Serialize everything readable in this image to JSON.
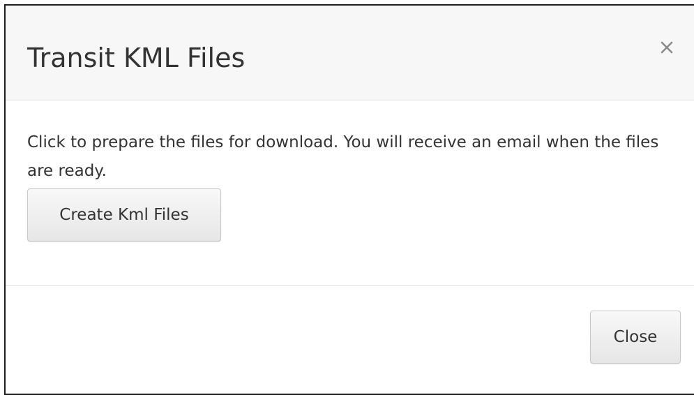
{
  "dialog": {
    "title": "Transit KML Files",
    "close_icon": "close-icon",
    "body_text": "Click to prepare the files for download. You will receive an email when the files are ready.",
    "create_button_label": "Create Kml Files",
    "close_button_label": "Close"
  },
  "colors": {
    "header_background": "#f7f7f7",
    "text": "#333333",
    "button_border": "#c8c8c8",
    "divider": "#e5e5e5"
  }
}
